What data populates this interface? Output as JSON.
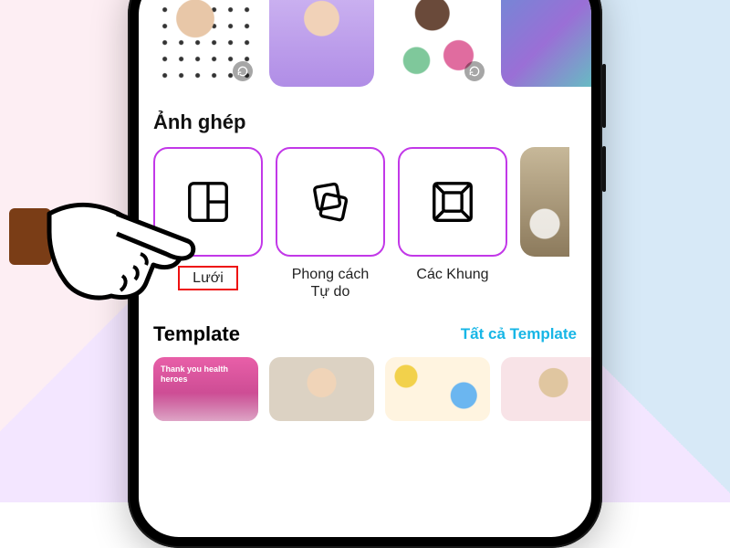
{
  "sections": {
    "collage": {
      "title": "Ảnh ghép",
      "cards": [
        {
          "id": "grid",
          "label": "Lưới"
        },
        {
          "id": "freestyle",
          "label_line1": "Phong cách",
          "label_line2": "Tự do"
        },
        {
          "id": "frames",
          "label": "Các Khung"
        }
      ]
    },
    "template": {
      "title": "Template",
      "see_all": "Tất cả Template",
      "items": [
        {
          "caption": "Thank you health heroes"
        }
      ]
    }
  },
  "icons": {
    "reload": "reload-icon",
    "grid": "grid-icon",
    "freestyle": "freestyle-icon",
    "frame": "frame-icon"
  },
  "colors": {
    "accent_purple": "#c238e8",
    "link_blue": "#17b6e6",
    "highlight_red": "#e11"
  }
}
